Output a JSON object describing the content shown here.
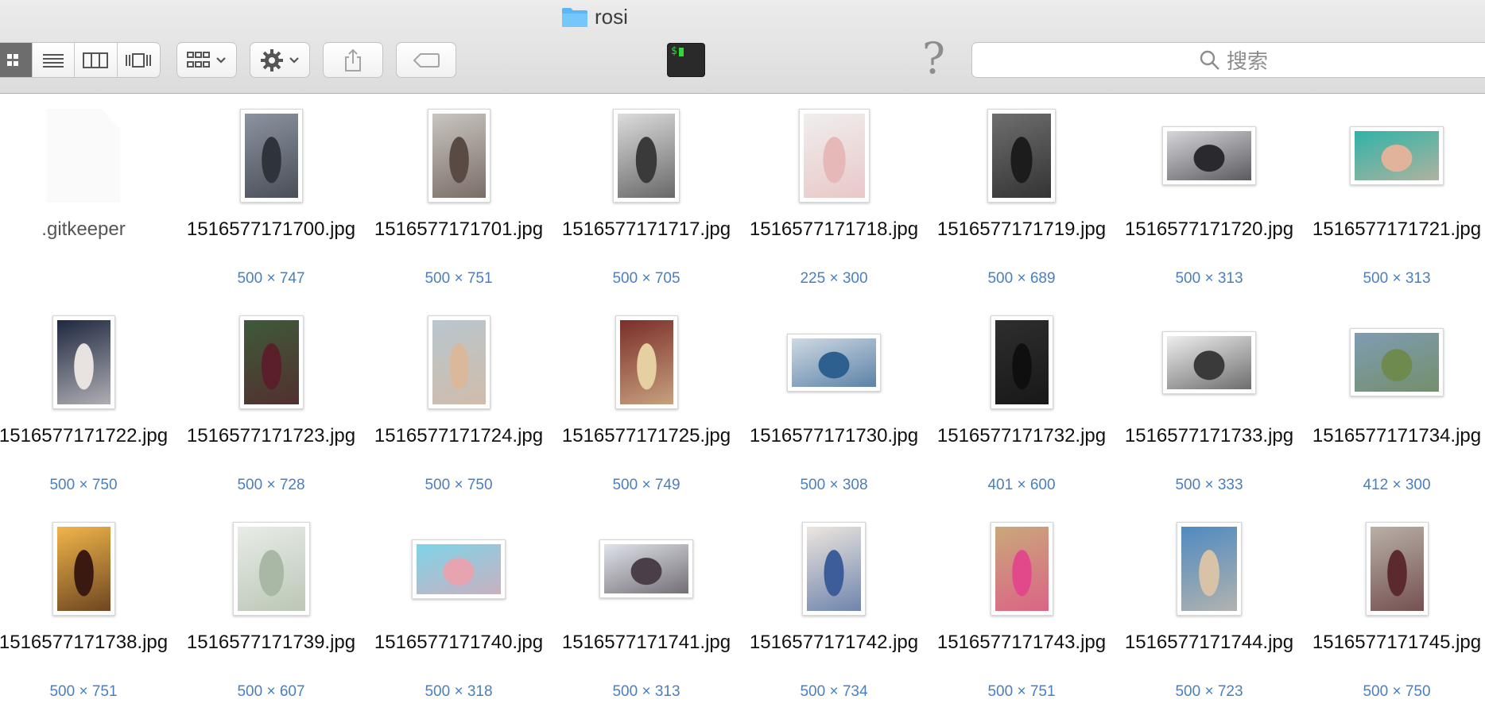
{
  "window": {
    "title": "rosi"
  },
  "toolbar": {
    "search_placeholder": "搜索",
    "terminal_label": "$"
  },
  "files": [
    {
      "name": ".gitkeeper",
      "dims": "",
      "type": "doc"
    },
    {
      "name": "1516577171700.jpg",
      "dims": "500 × 747",
      "w": 500,
      "h": 747,
      "colors": [
        "#8c93a0",
        "#2f333a"
      ]
    },
    {
      "name": "1516577171701.jpg",
      "dims": "500 × 751",
      "w": 500,
      "h": 751,
      "colors": [
        "#c9c5c0",
        "#5a4a44"
      ]
    },
    {
      "name": "1516577171717.jpg",
      "dims": "500 × 705",
      "w": 500,
      "h": 705,
      "colors": [
        "#dcdcdc",
        "#3a3a3a"
      ]
    },
    {
      "name": "1516577171718.jpg",
      "dims": "225 × 300",
      "w": 225,
      "h": 300,
      "colors": [
        "#f0eeee",
        "#e6b8b8"
      ]
    },
    {
      "name": "1516577171719.jpg",
      "dims": "500 × 689",
      "w": 500,
      "h": 689,
      "colors": [
        "#6e6e6e",
        "#1c1c1c"
      ]
    },
    {
      "name": "1516577171720.jpg",
      "dims": "500 × 313",
      "w": 500,
      "h": 313,
      "colors": [
        "#d6d6da",
        "#2a2a2e"
      ]
    },
    {
      "name": "1516577171721.jpg",
      "dims": "500 × 313",
      "w": 500,
      "h": 313,
      "colors": [
        "#2fb3a8",
        "#e1b39a"
      ]
    },
    {
      "name": "1516577171722.jpg",
      "dims": "500 × 750",
      "w": 500,
      "h": 750,
      "colors": [
        "#1f2840",
        "#e8e3e0"
      ]
    },
    {
      "name": "1516577171723.jpg",
      "dims": "500 × 728",
      "w": 500,
      "h": 728,
      "colors": [
        "#3e5a3a",
        "#5a1f2a"
      ]
    },
    {
      "name": "1516577171724.jpg",
      "dims": "500 × 750",
      "w": 500,
      "h": 750,
      "colors": [
        "#b9c6ce",
        "#d9b89c"
      ]
    },
    {
      "name": "1516577171725.jpg",
      "dims": "500 × 749",
      "w": 500,
      "h": 749,
      "colors": [
        "#7a2e2a",
        "#e6cfa0"
      ]
    },
    {
      "name": "1516577171730.jpg",
      "dims": "500 × 308",
      "w": 500,
      "h": 308,
      "colors": [
        "#cfd9e3",
        "#2d5f8f"
      ]
    },
    {
      "name": "1516577171732.jpg",
      "dims": "401 × 600",
      "w": 401,
      "h": 600,
      "colors": [
        "#2e2e2e",
        "#0f0f0f"
      ]
    },
    {
      "name": "1516577171733.jpg",
      "dims": "500 × 333",
      "w": 500,
      "h": 333,
      "colors": [
        "#eeeeee",
        "#3a3a3a"
      ]
    },
    {
      "name": "1516577171734.jpg",
      "dims": "412 × 300",
      "w": 412,
      "h": 300,
      "colors": [
        "#7f9cb3",
        "#6f8a4f"
      ]
    },
    {
      "name": "1516577171738.jpg",
      "dims": "500 × 751",
      "w": 500,
      "h": 751,
      "colors": [
        "#f0b54a",
        "#3a1a10"
      ]
    },
    {
      "name": "1516577171739.jpg",
      "dims": "500 × 607",
      "w": 500,
      "h": 607,
      "colors": [
        "#e8ece6",
        "#a9b8a4"
      ]
    },
    {
      "name": "1516577171740.jpg",
      "dims": "500 × 318",
      "w": 500,
      "h": 318,
      "colors": [
        "#7fd3e8",
        "#e6a3b0"
      ]
    },
    {
      "name": "1516577171741.jpg",
      "dims": "500 × 313",
      "w": 500,
      "h": 313,
      "colors": [
        "#dfe3ea",
        "#4a3f48"
      ]
    },
    {
      "name": "1516577171742.jpg",
      "dims": "500 × 734",
      "w": 500,
      "h": 734,
      "colors": [
        "#ece6de",
        "#3d5d9a"
      ]
    },
    {
      "name": "1516577171743.jpg",
      "dims": "500 × 751",
      "w": 500,
      "h": 751,
      "colors": [
        "#c9a87a",
        "#e2498a"
      ]
    },
    {
      "name": "1516577171744.jpg",
      "dims": "500 × 723",
      "w": 500,
      "h": 723,
      "colors": [
        "#4f8ac0",
        "#d9c3a8"
      ]
    },
    {
      "name": "1516577171745.jpg",
      "dims": "500 × 750",
      "w": 500,
      "h": 750,
      "colors": [
        "#b8b0a6",
        "#5a2a30"
      ]
    }
  ],
  "colors": {
    "dims_text": "#4a7fbf",
    "toolbar_bg": "#e4e4e4",
    "folder": "#5ab6f5"
  }
}
